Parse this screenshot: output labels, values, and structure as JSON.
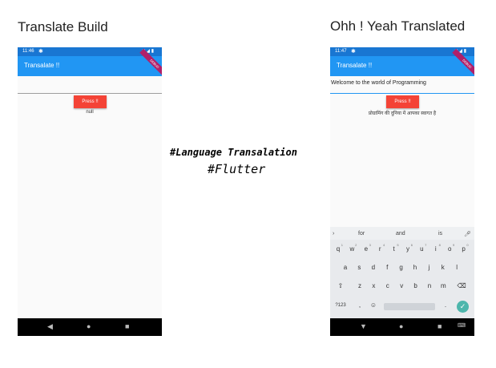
{
  "left": {
    "heading": "Translate Build",
    "status_time": "11:46",
    "app_title": "Transalate !!",
    "debug_label": "DEBUG",
    "input_value": "",
    "press_label": "Press !!",
    "result_text": "null"
  },
  "right": {
    "heading": "Ohh ! Yeah Translated",
    "status_time": "11:47",
    "app_title": "Transalate !!",
    "debug_label": "DEBUG",
    "input_value": "Welcome to the world of Programming",
    "press_label": "Press !!",
    "result_text": "प्रोग्रामिंग की दुनिया में आपका स्वागत है"
  },
  "center": {
    "line1": "#Language Transalation",
    "line2": "#Flutter"
  },
  "keyboard": {
    "suggestions": [
      "for",
      "and",
      "is"
    ],
    "row1": [
      "q",
      "w",
      "e",
      "r",
      "t",
      "y",
      "u",
      "i",
      "o",
      "p"
    ],
    "row1_hints": [
      "1",
      "2",
      "3",
      "4",
      "5",
      "6",
      "7",
      "8",
      "9",
      "0"
    ],
    "row2": [
      "a",
      "s",
      "d",
      "f",
      "g",
      "h",
      "j",
      "k",
      "l"
    ],
    "row3": [
      "z",
      "x",
      "c",
      "v",
      "b",
      "n",
      "m"
    ],
    "symbols_key": "?123",
    "comma": ",",
    "period": "."
  }
}
